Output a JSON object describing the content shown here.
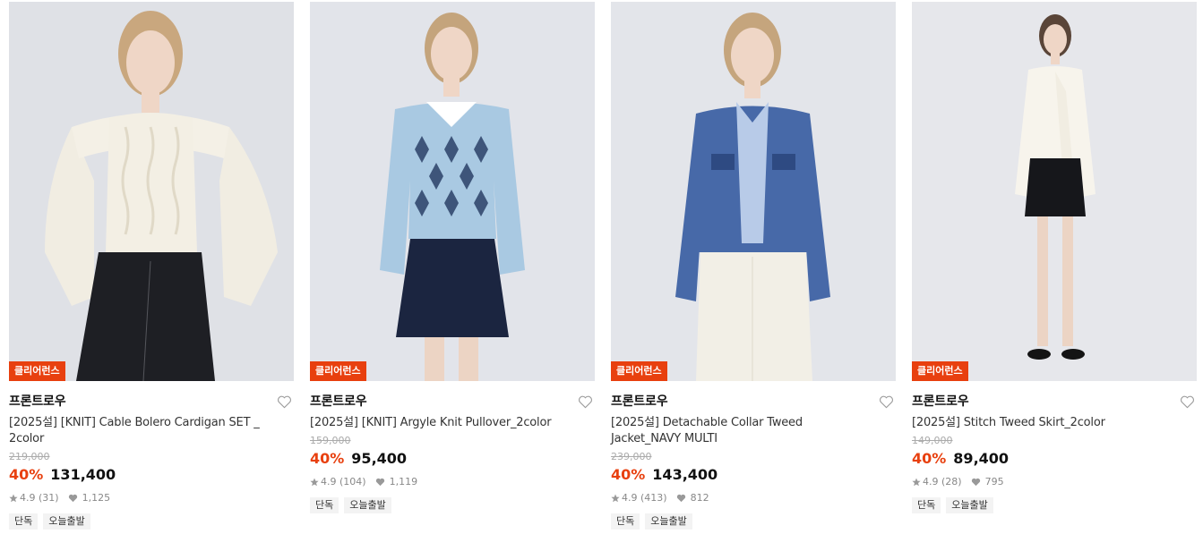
{
  "products": [
    {
      "badge": "클리어런스",
      "brand": "프론트로우",
      "name": "[2025설] [KNIT] Cable Bolero Cardigan SET _ 2color",
      "original_price": "219,000",
      "discount": "40%",
      "price": "131,400",
      "rating": "4.9 (31)",
      "likes": "1,125",
      "tags": [
        "단독",
        "오늘출발"
      ],
      "image_icon": "cream-cable-bolero-cardigan-photo"
    },
    {
      "badge": "클리어런스",
      "brand": "프론트로우",
      "name": "[2025설] [KNIT] Argyle Knit Pullover_2color",
      "original_price": "159,000",
      "discount": "40%",
      "price": "95,400",
      "rating": "4.9 (104)",
      "likes": "1,119",
      "tags": [
        "단독",
        "오늘출발"
      ],
      "image_icon": "blue-argyle-pullover-photo"
    },
    {
      "badge": "클리어런스",
      "brand": "프론트로우",
      "name": "[2025설] Detachable Collar Tweed Jacket_NAVY MULTI",
      "original_price": "239,000",
      "discount": "40%",
      "price": "143,400",
      "rating": "4.9 (413)",
      "likes": "812",
      "tags": [
        "단독",
        "오늘출발"
      ],
      "image_icon": "blue-tweed-jacket-photo"
    },
    {
      "badge": "클리어런스",
      "brand": "프론트로우",
      "name": "[2025설] Stitch Tweed Skirt_2color",
      "original_price": "149,000",
      "discount": "40%",
      "price": "89,400",
      "rating": "4.9 (28)",
      "likes": "795",
      "tags": [
        "단독",
        "오늘출발"
      ],
      "image_icon": "black-stitch-tweed-skirt-photo"
    }
  ],
  "colors": {
    "accent": "#e8400f",
    "strike": "#aaaaaa",
    "tag_bg": "#f3f3f3"
  }
}
